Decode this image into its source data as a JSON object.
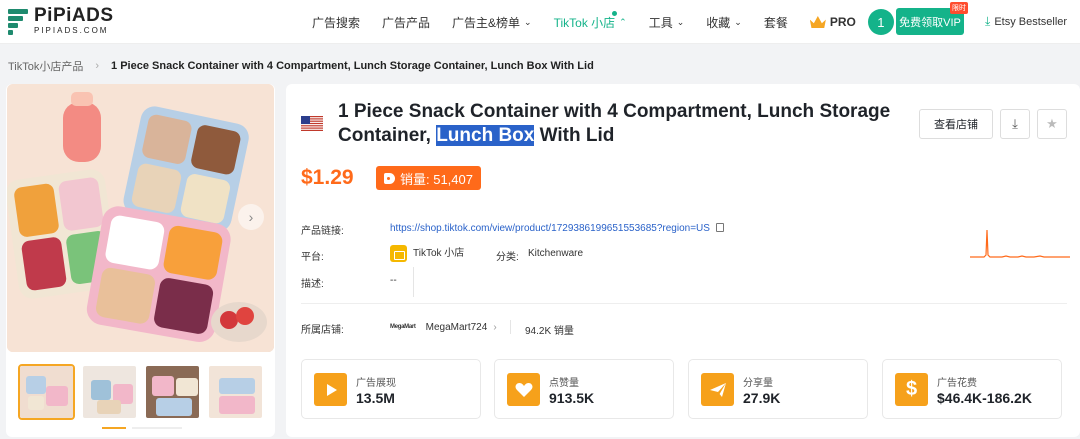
{
  "brand": {
    "name": "PiPiADS",
    "domain": "PIPIADS.COM",
    "color": "#1e8a6e"
  },
  "nav": {
    "items": [
      "广告搜索",
      "广告产品",
      "广告主&榜单",
      "TikTok 小店",
      "工具",
      "收藏",
      "套餐"
    ],
    "pro_label": "PRO",
    "avatar_text": "1",
    "vip_button": "免费领取VIP",
    "vip_badge": "限时",
    "etsy_label": "Etsy Bestseller"
  },
  "breadcrumb": {
    "parent": "TikTok小店产品",
    "current": "1 Piece Snack Container with 4 Compartment, Lunch Storage Container, Lunch Box With Lid"
  },
  "product": {
    "title_before": "1 Piece Snack Container with 4 Compartment, Lunch Storage Container, ",
    "title_highlight": "Lunch Box",
    "title_after": " With Lid",
    "price": "$1.29",
    "sales": "销量: 51,407",
    "view_store_button": "查看店铺",
    "link_label": "产品链接:",
    "link_value": "https://shop.tiktok.com/view/product/1729386199651553685?region=US",
    "platform_label": "平台:",
    "platform_value": "TikTok 小店",
    "category_label": "分类:",
    "category_value": "Kitchenware",
    "description_label": "描述:",
    "description_value": "--",
    "store_label": "所属店铺:",
    "store_logo_text": "MegaMart",
    "store_name": "MegaMart724",
    "store_sales": "94.2K 销量"
  },
  "stats": [
    {
      "label": "广告展现",
      "value": "13.5M",
      "icon": "play-icon"
    },
    {
      "label": "点赞量",
      "value": "913.5K",
      "icon": "heart-icon"
    },
    {
      "label": "分享量",
      "value": "27.9K",
      "icon": "share-icon"
    },
    {
      "label": "广告花费",
      "value": "$46.4K-186.2K",
      "icon": "dollar-icon"
    }
  ],
  "colors": {
    "accent": "#14b38a",
    "price": "#ff6a1a",
    "stat_icon": "#f6a11b",
    "highlight": "#2a62c9"
  }
}
